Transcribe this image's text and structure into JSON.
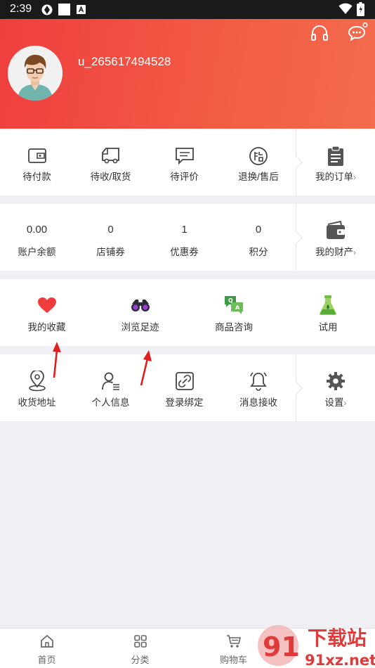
{
  "status_bar": {
    "time": "2:39"
  },
  "profile": {
    "username": "u_265617494528"
  },
  "orders": {
    "items": [
      {
        "label": "待付款",
        "icon": "wallet-icon"
      },
      {
        "label": "待收/取货",
        "icon": "truck-icon"
      },
      {
        "label": "待评价",
        "icon": "comment-icon"
      },
      {
        "label": "退换/售后",
        "icon": "after-sale-icon"
      }
    ],
    "side": {
      "label": "我的订单",
      "icon": "clipboard-icon"
    }
  },
  "assets": {
    "items": [
      {
        "value": "0.00",
        "label": "账户余额"
      },
      {
        "value": "0",
        "label": "店铺券"
      },
      {
        "value": "1",
        "label": "优惠券"
      },
      {
        "value": "0",
        "label": "积分"
      }
    ],
    "side": {
      "label": "我的财产",
      "icon": "wallet-dark-icon"
    }
  },
  "features": {
    "items": [
      {
        "label": "我的收藏",
        "icon": "heart-icon"
      },
      {
        "label": "浏览足迹",
        "icon": "binoculars-icon"
      },
      {
        "label": "商品咨询",
        "icon": "qa-chat-icon"
      },
      {
        "label": "试用",
        "icon": "flask-icon"
      }
    ]
  },
  "tools": {
    "items": [
      {
        "label": "收货地址",
        "icon": "location-pin-icon"
      },
      {
        "label": "个人信息",
        "icon": "user-info-icon"
      },
      {
        "label": "登录绑定",
        "icon": "link-icon"
      },
      {
        "label": "消息接收",
        "icon": "bell-icon"
      }
    ],
    "side": {
      "label": "设置",
      "icon": "gear-icon"
    }
  },
  "chevron": "›",
  "tabbar": {
    "items": [
      {
        "label": "首页",
        "icon": "home-icon"
      },
      {
        "label": "分类",
        "icon": "category-icon"
      },
      {
        "label": "购物车",
        "icon": "cart-icon"
      }
    ]
  },
  "watermark": {
    "text": "下载站",
    "domain": "91xz.net",
    "logo": "91"
  },
  "colors": {
    "accent": "#ef3e3e",
    "header_end": "#f36c4e",
    "heart": "#f03c3c",
    "green": "#5cb85c"
  }
}
